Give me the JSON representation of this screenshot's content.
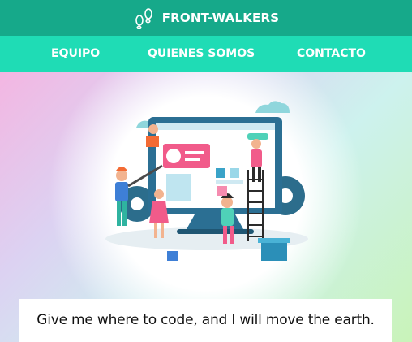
{
  "header": {
    "brand_name": "FRONT-WALKERS",
    "logo_icon": "footprints-icon",
    "background_color": "#16a98a"
  },
  "nav": {
    "background_color": "#1fdcb5",
    "items": [
      {
        "label": "EQUIPO"
      },
      {
        "label": "QUIENES SOMOS"
      },
      {
        "label": "CONTACTO"
      }
    ]
  },
  "hero": {
    "illustration": "web-development-team-illustration",
    "motto": "Give me where to code, and I will move the earth."
  }
}
